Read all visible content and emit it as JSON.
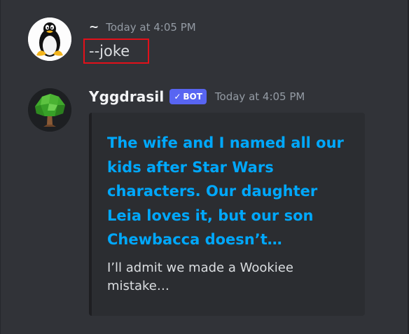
{
  "messages": [
    {
      "author": "~",
      "timestamp": "Today at 4:05 PM",
      "content": "--joke",
      "avatar_icon": "tux-penguin-icon"
    },
    {
      "author": "Yggdrasil",
      "badge": "BOT",
      "timestamp": "Today at 4:05 PM",
      "avatar_icon": "tree-icon",
      "embed": {
        "title": "The wife and I named all our kids after Star Wars characters. Our daughter Leia loves it, but our son Chewbacca doesn’t…",
        "description": "I’ll admit we made a Wookiee mistake…",
        "title_color": "#00a8fc"
      }
    }
  ],
  "colors": {
    "background": "#313338",
    "embed_background": "#2b2d31",
    "bot_badge": "#5865f2",
    "highlight_border": "#e3101a"
  }
}
